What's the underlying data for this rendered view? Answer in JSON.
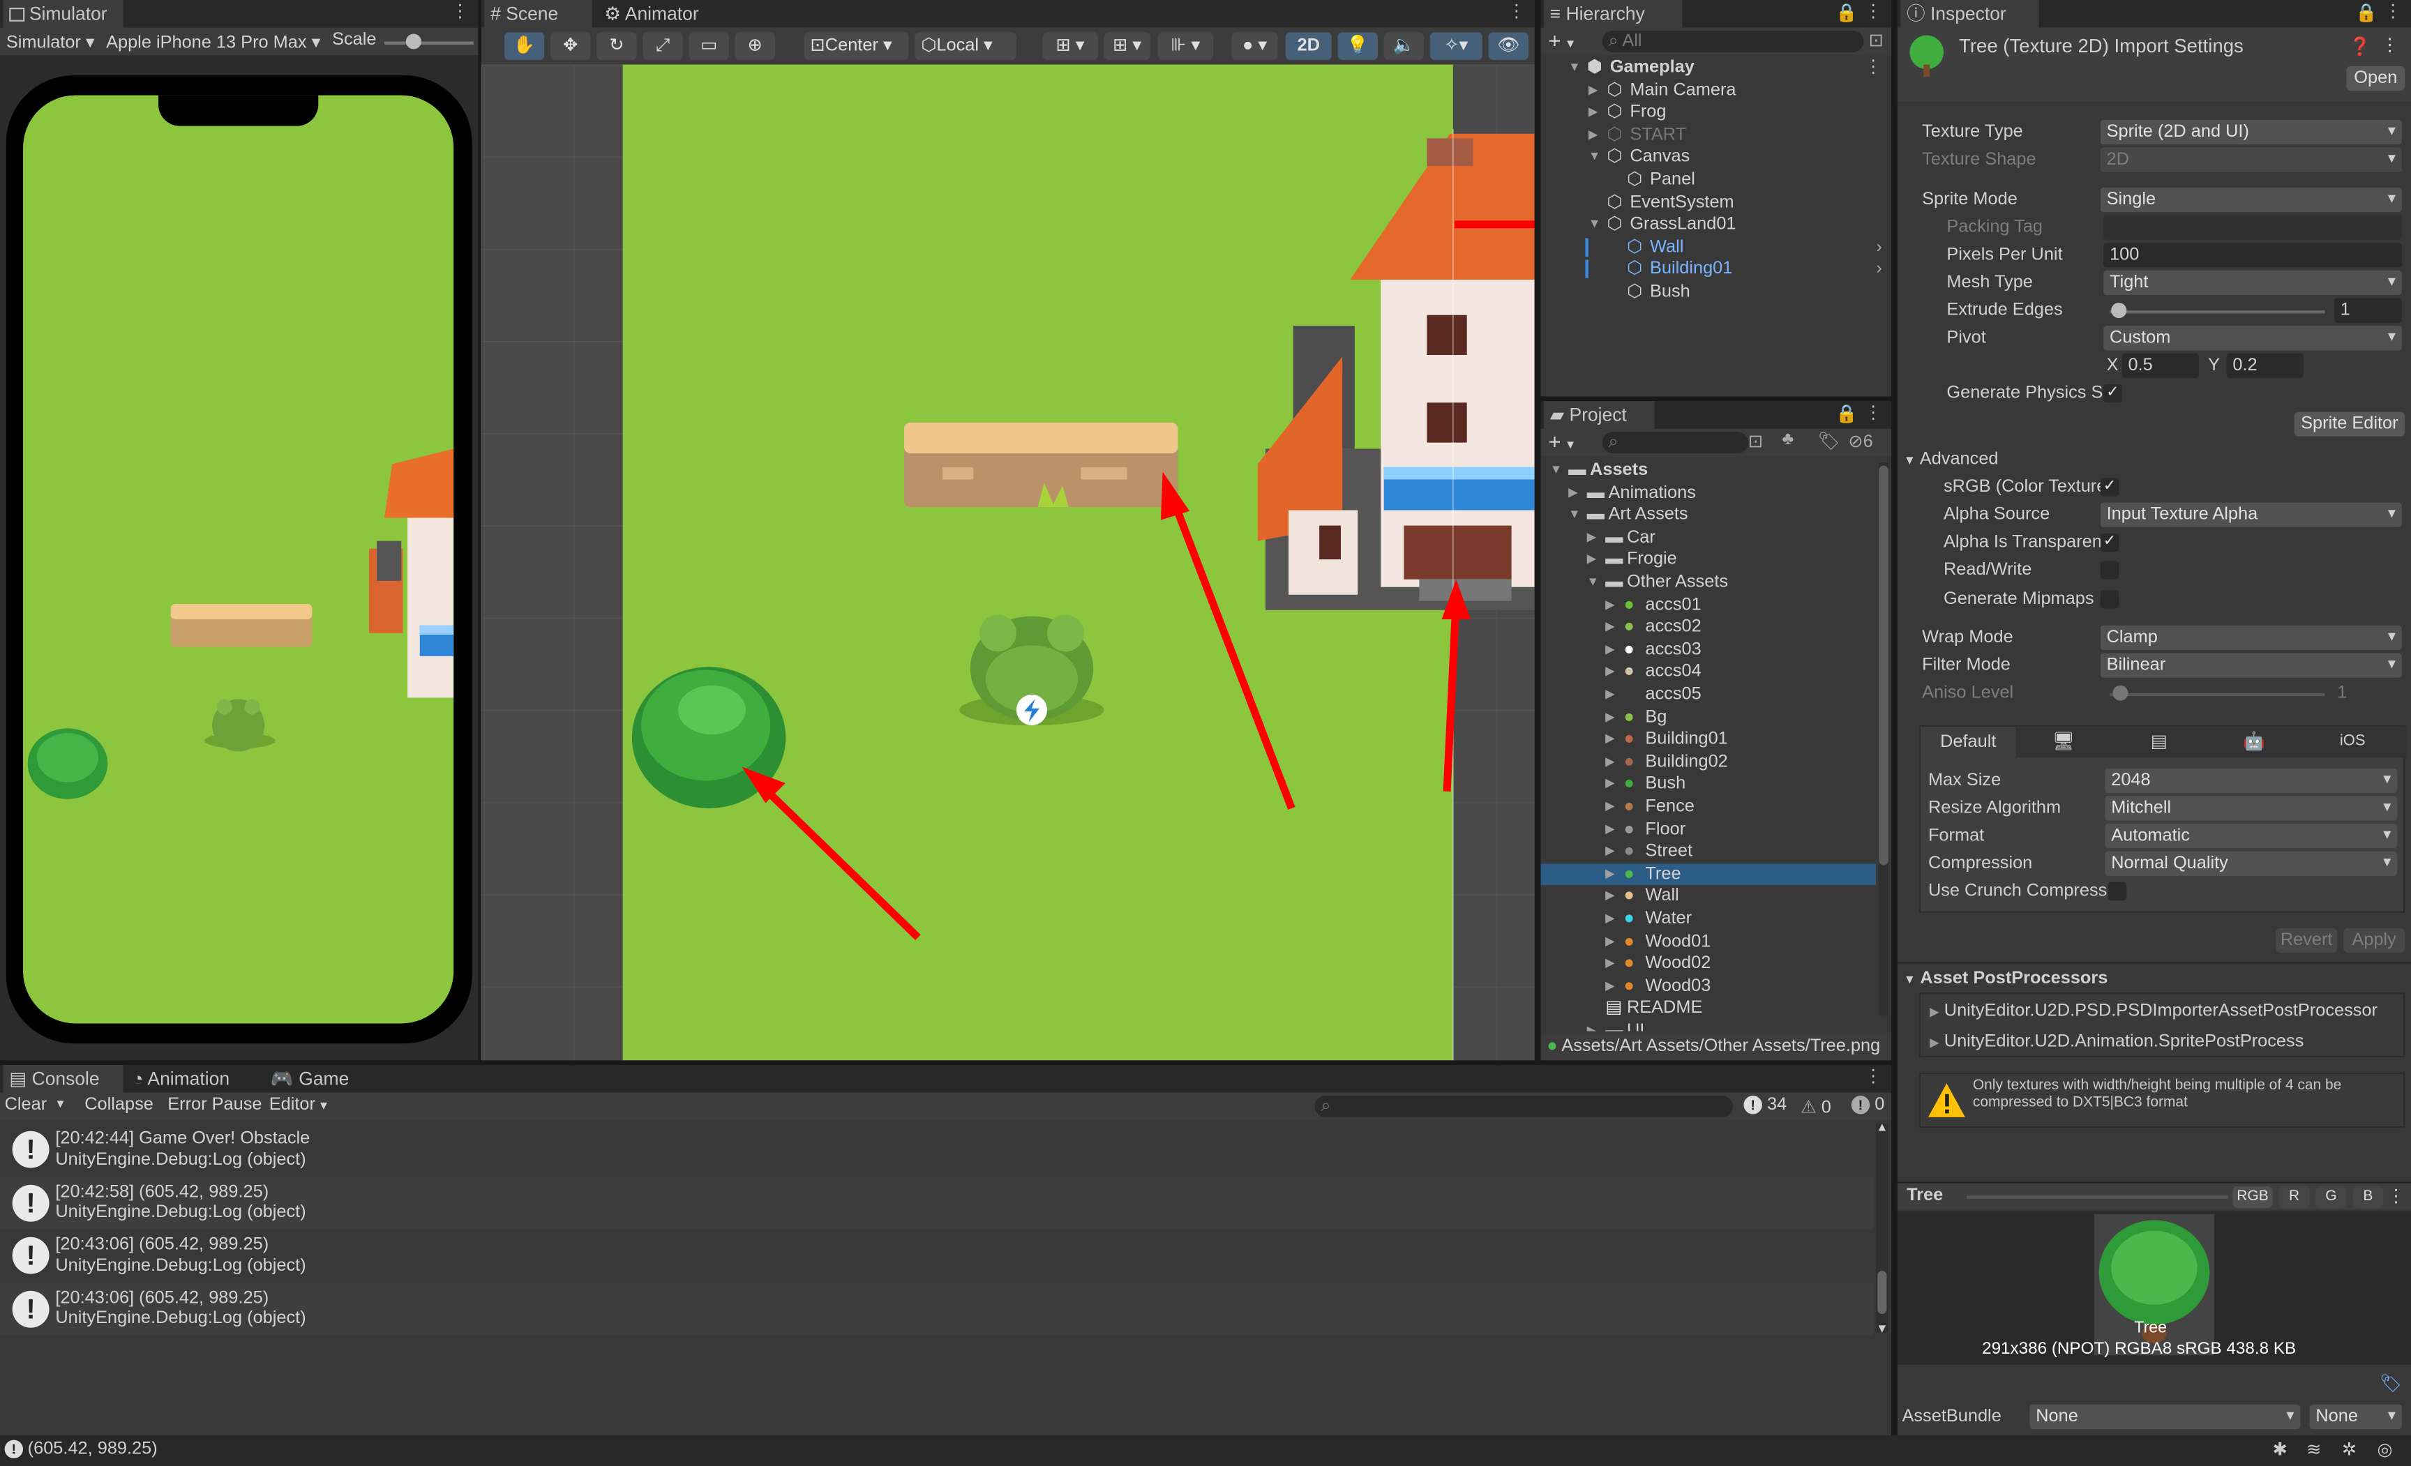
{
  "simulator": {
    "tab": "Simulator",
    "mode": "Simulator",
    "device": "Apple iPhone 13 Pro Max",
    "scale_label": "Scale"
  },
  "scene": {
    "tabs": [
      "Scene",
      "Animator"
    ],
    "center": "Center",
    "local": "Local",
    "mode_2d": "2D"
  },
  "hierarchy": {
    "tab": "Hierarchy",
    "search_placeholder": "All",
    "items": [
      {
        "label": "Gameplay",
        "depth": 0,
        "expanded": true,
        "bold": true,
        "scene": true
      },
      {
        "label": "Main Camera",
        "depth": 1,
        "expanded": false,
        "arrow": true
      },
      {
        "label": "Frog",
        "depth": 1,
        "expanded": false,
        "arrow": true
      },
      {
        "label": "START",
        "depth": 1,
        "expanded": false,
        "arrow": true,
        "dim": true
      },
      {
        "label": "Canvas",
        "depth": 1,
        "expanded": true,
        "arrow": true
      },
      {
        "label": "Panel",
        "depth": 2
      },
      {
        "label": "EventSystem",
        "depth": 1
      },
      {
        "label": "GrassLand01",
        "depth": 1,
        "expanded": true,
        "arrow": true
      },
      {
        "label": "Wall",
        "depth": 2,
        "prefab": true,
        "more": true
      },
      {
        "label": "Building01",
        "depth": 2,
        "prefab": true,
        "more": true
      },
      {
        "label": "Bush",
        "depth": 2
      }
    ]
  },
  "project": {
    "tab": "Project",
    "hidden_count": "6",
    "items": [
      {
        "label": "Assets",
        "depth": 0,
        "folder": true,
        "arrow": "open",
        "bold": true
      },
      {
        "label": "Animations",
        "depth": 1,
        "folder": true,
        "arrow": "closed"
      },
      {
        "label": "Art Assets",
        "depth": 1,
        "folder": true,
        "arrow": "open"
      },
      {
        "label": "Car",
        "depth": 2,
        "folder": true,
        "arrow": "closed"
      },
      {
        "label": "Frogie",
        "depth": 2,
        "folder": true,
        "arrow": "closed"
      },
      {
        "label": "Other Assets",
        "depth": 2,
        "folder": true,
        "arrow": "open"
      },
      {
        "label": "accs01",
        "depth": 3,
        "arrow": "closed",
        "color": "#6bbf3a"
      },
      {
        "label": "accs02",
        "depth": 3,
        "arrow": "closed",
        "color": "#8bc24a"
      },
      {
        "label": "accs03",
        "depth": 3,
        "arrow": "closed",
        "color": "#ffffff"
      },
      {
        "label": "accs04",
        "depth": 3,
        "arrow": "closed",
        "color": "#cfc7a8"
      },
      {
        "label": "accs05",
        "depth": 3,
        "arrow": "closed",
        "color": "#383838"
      },
      {
        "label": "Bg",
        "depth": 3,
        "arrow": "closed",
        "color": "#8bc34a"
      },
      {
        "label": "Building01",
        "depth": 3,
        "arrow": "closed",
        "color": "#c0644a"
      },
      {
        "label": "Building02",
        "depth": 3,
        "arrow": "closed",
        "color": "#a36a4a"
      },
      {
        "label": "Bush",
        "depth": 3,
        "arrow": "closed",
        "color": "#3fae3f"
      },
      {
        "label": "Fence",
        "depth": 3,
        "arrow": "closed",
        "color": "#b07a4a"
      },
      {
        "label": "Floor",
        "depth": 3,
        "arrow": "closed",
        "color": "#9a9a9a"
      },
      {
        "label": "Street",
        "depth": 3,
        "arrow": "closed",
        "color": "#8a8a8a"
      },
      {
        "label": "Tree",
        "depth": 3,
        "arrow": "closed",
        "color": "#4cb84c",
        "selected": true
      },
      {
        "label": "Wall",
        "depth": 3,
        "arrow": "closed",
        "color": "#e6c08a"
      },
      {
        "label": "Water",
        "depth": 3,
        "arrow": "closed",
        "color": "#3ed6e6"
      },
      {
        "label": "Wood01",
        "depth": 3,
        "arrow": "closed",
        "color": "#e2892c"
      },
      {
        "label": "Wood02",
        "depth": 3,
        "arrow": "closed",
        "color": "#e2892c"
      },
      {
        "label": "Wood03",
        "depth": 3,
        "arrow": "closed",
        "color": "#e2892c"
      },
      {
        "label": "README",
        "depth": 2,
        "doc": true
      },
      {
        "label": "UI",
        "depth": 2,
        "folder": true,
        "arrow": "closed"
      }
    ],
    "path": "Assets/Art Assets/Other Assets/Tree.png"
  },
  "inspector": {
    "tab": "Inspector",
    "title": "Tree (Texture 2D) Import Settings",
    "open_label": "Open",
    "texture_type_label": "Texture Type",
    "texture_type": "Sprite (2D and UI)",
    "texture_shape_label": "Texture Shape",
    "texture_shape": "2D",
    "sprite_mode_label": "Sprite Mode",
    "sprite_mode": "Single",
    "packing_tag_label": "Packing Tag",
    "ppu_label": "Pixels Per Unit",
    "ppu": "100",
    "mesh_type_label": "Mesh Type",
    "mesh_type": "Tight",
    "extrude_label": "Extrude Edges",
    "extrude": "1",
    "pivot_label": "Pivot",
    "pivot": "Custom",
    "pivot_x_label": "X",
    "pivot_x": "0.5",
    "pivot_y_label": "Y",
    "pivot_y": "0.2",
    "gen_physics_label": "Generate Physics S",
    "sprite_editor_label": "Sprite Editor",
    "advanced_label": "Advanced",
    "srgb_label": "sRGB (Color Texture",
    "alpha_source_label": "Alpha Source",
    "alpha_source": "Input Texture Alpha",
    "alpha_transp_label": "Alpha Is Transparen",
    "readwrite_label": "Read/Write",
    "mipmaps_label": "Generate Mipmaps",
    "wrap_label": "Wrap Mode",
    "wrap": "Clamp",
    "filter_label": "Filter Mode",
    "filter": "Bilinear",
    "aniso_label": "Aniso Level",
    "aniso": "1",
    "platform_default": "Default",
    "platform_ios": "iOS",
    "max_size_label": "Max Size",
    "max_size": "2048",
    "resize_label": "Resize Algorithm",
    "resize": "Mitchell",
    "format_label": "Format",
    "format": "Automatic",
    "compression_label": "Compression",
    "compression": "Normal Quality",
    "crunch_label": "Use Crunch Compress",
    "revert": "Revert",
    "apply": "Apply",
    "postproc_label": "Asset PostProcessors",
    "postproc": [
      "UnityEditor.U2D.PSD.PSDImporterAssetPostProcessor",
      "UnityEditor.U2D.Animation.SpritePostProcess"
    ],
    "warning": "Only textures with width/height being multiple of 4 can be compressed to DXT5|BC3 format",
    "preview_name": "Tree",
    "channels": [
      "RGB",
      "R",
      "G",
      "B"
    ],
    "preview_caption": "Tree",
    "preview_info": "291x386 (NPOT)  RGBA8 sRGB   438.8 KB",
    "assetbundle_label": "AssetBundle",
    "assetbundle": "None",
    "variant": "None"
  },
  "console": {
    "tabs": [
      "Console",
      "Animation",
      "Game"
    ],
    "clear": "Clear",
    "collapse": "Collapse",
    "error_pause": "Error Pause",
    "editor": "Editor",
    "log_count": "34",
    "warn_count": "0",
    "err_count": "0",
    "entries": [
      {
        "line1": "[20:42:44] Game Over! Obstacle",
        "line2": "UnityEngine.Debug:Log (object)"
      },
      {
        "line1": "[20:42:58] (605.42, 989.25)",
        "line2": "UnityEngine.Debug:Log (object)"
      },
      {
        "line1": "[20:43:06] (605.42, 989.25)",
        "line2": "UnityEngine.Debug:Log (object)"
      },
      {
        "line1": "[20:43:06] (605.42, 989.25)",
        "line2": "UnityEngine.Debug:Log (object)"
      }
    ]
  },
  "statusbar": {
    "text": "(605.42, 989.25)"
  },
  "colors": {
    "grass": "#8cc63f",
    "selection": "#2c5d87",
    "arrow": "#ff0000",
    "prefab_text": "#7ab4ff"
  }
}
